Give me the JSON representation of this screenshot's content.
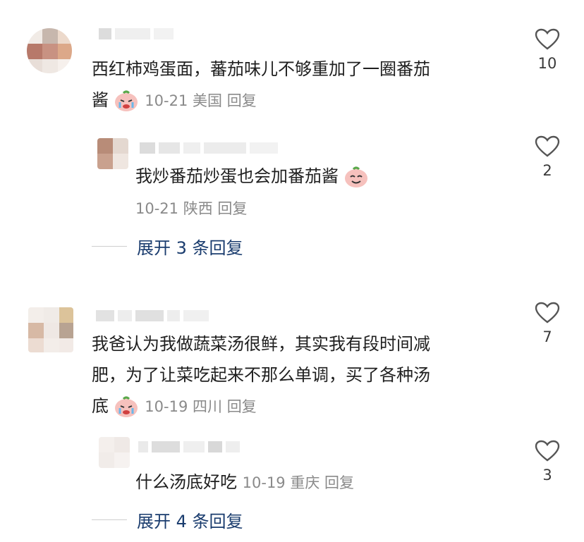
{
  "comments": [
    {
      "text_lines": [
        "西红柿鸡蛋面，蕃茄味儿不够重加了一圈番茄",
        "酱"
      ],
      "date": "10-21",
      "location": "美国",
      "reply_label": "回复",
      "likes": "10",
      "emoji": "crying-face"
    },
    {
      "text_lines": [
        "我爸认为我做蔬菜汤很鲜，其实我有段时间减",
        "肥，为了让菜吃起来不那么单调，买了各种汤",
        "底"
      ],
      "date": "10-19",
      "location": "四川",
      "reply_label": "回复",
      "likes": "7",
      "emoji": "crying-face"
    }
  ],
  "replies": [
    {
      "text": "我炒番茄炒蛋也会加番茄酱",
      "date": "10-21",
      "location": "陕西",
      "reply_label": "回复",
      "likes": "2",
      "emoji": "smiling-face"
    },
    {
      "text": "什么汤底好吃",
      "date": "10-19",
      "location": "重庆",
      "reply_label": "回复",
      "likes": "3"
    }
  ],
  "expand": [
    {
      "label": "展开 3 条回复"
    },
    {
      "label": "展开 4 条回复"
    }
  ],
  "colors": {
    "link": "#1a3c6e",
    "meta": "#8a8a8a",
    "text": "#1f1f1f"
  },
  "icons": [
    "heart-outline-icon",
    "crying-emoji-icon",
    "smiling-emoji-icon"
  ]
}
